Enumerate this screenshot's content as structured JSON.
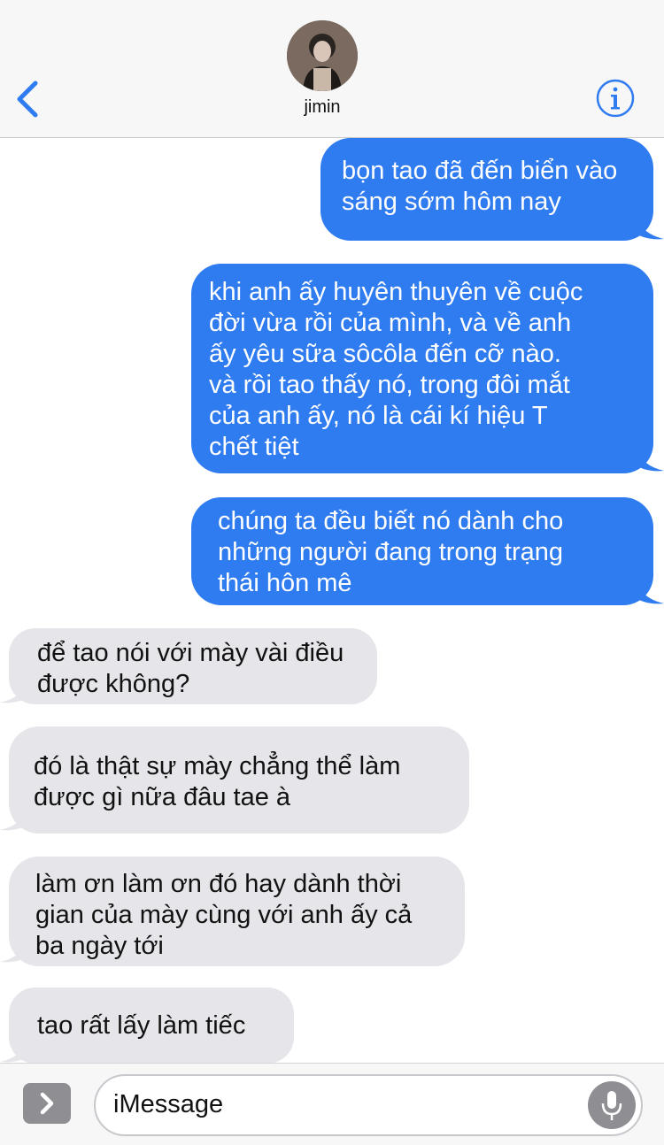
{
  "header": {
    "contact_name": "jimin",
    "back_icon": "chevron-left-icon",
    "info_icon": "info-icon",
    "accent": "#2f7bf0"
  },
  "messages": [
    {
      "direction": "out",
      "text": "bọn tao đã đến biển vào\nsáng sớm hôm nay"
    },
    {
      "direction": "out",
      "text": "khi anh ấy huyên thuyên về cuộc\nđời vừa rồi của mình, và về anh\nấy yêu sữa sôcôla đến cỡ nào.\nvà rồi tao thấy nó, trong đôi mắt\ncủa anh ấy, nó là cái kí hiệu T\nchết tiệt"
    },
    {
      "direction": "out",
      "text": "chúng ta đều biết nó dành cho\nnhững người đang trong trạng\nthái hôn mê"
    },
    {
      "direction": "in",
      "text": "để tao nói với mày vài điều\nđược không?"
    },
    {
      "direction": "in",
      "text": "đó là thật sự mày chẳng thể làm\nđược gì nữa đâu tae à"
    },
    {
      "direction": "in",
      "text": "làm ơn làm ơn đó hay dành thời\ngian của mày cùng với anh ấy cả\nba ngày tới"
    },
    {
      "direction": "in",
      "text": "tao rất lấy làm tiếc"
    }
  ],
  "composer": {
    "placeholder": "iMessage",
    "apps_icon": "chevron-right-icon",
    "mic_icon": "microphone-icon"
  },
  "colors": {
    "outgoing_bubble": "#2f7bf0",
    "incoming_bubble": "#e5e5ea"
  }
}
